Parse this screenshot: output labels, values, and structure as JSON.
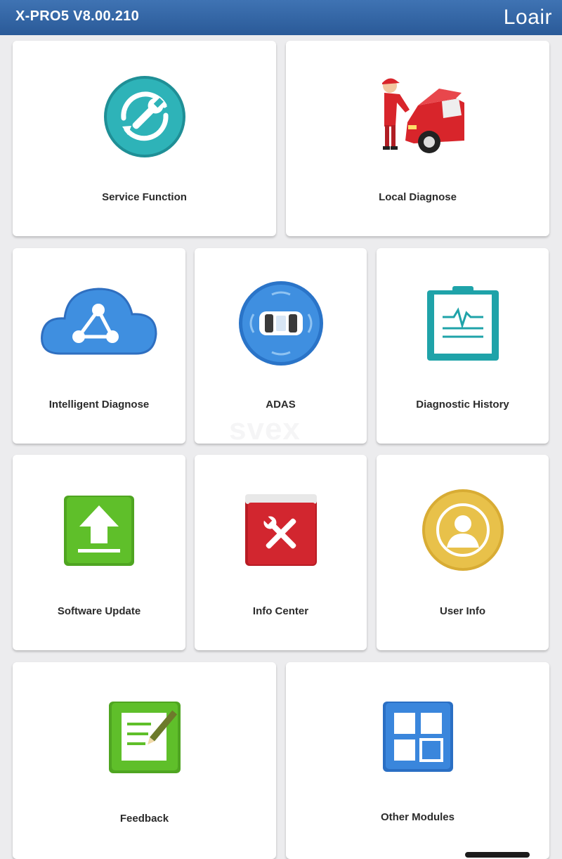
{
  "app": {
    "title": "X-PRO5 V8.00.210",
    "login_label": "Loair"
  },
  "watermark": "svex",
  "tiles": [
    {
      "label": "Service Function",
      "icon": "service-wrench-icon"
    },
    {
      "label": "Local Diagnose",
      "icon": "mechanic-car-icon"
    },
    {
      "label": "Intelligent Diagnose",
      "icon": "cloud-share-icon"
    },
    {
      "label": "ADAS",
      "icon": "adas-car-icon"
    },
    {
      "label": "Diagnostic History",
      "icon": "clipboard-waveform-icon"
    },
    {
      "label": "Software Update",
      "icon": "upload-arrow-icon"
    },
    {
      "label": "Info Center",
      "icon": "red-book-tools-icon"
    },
    {
      "label": "User Info",
      "icon": "user-avatar-icon"
    },
    {
      "label": "Feedback",
      "icon": "notepad-pencil-icon"
    },
    {
      "label": "Other Modules",
      "icon": "grid-modules-icon"
    }
  ],
  "colors": {
    "topbar": "#3566a8",
    "teal": "#2eb3b8",
    "blue": "#3f8fe0",
    "green": "#5fbf2a",
    "red": "#d2262f",
    "gold": "#e8c14a"
  }
}
